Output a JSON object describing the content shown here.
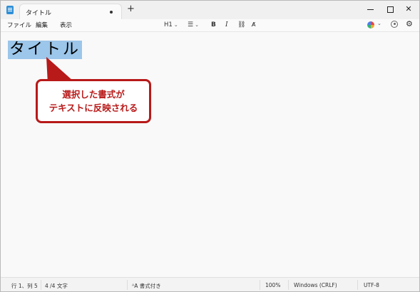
{
  "tab": {
    "title": "タイトル"
  },
  "menu": {
    "file": "ファイル",
    "edit": "編集",
    "view": "表示"
  },
  "toolbar": {
    "heading": "H1",
    "bold": "B",
    "italic": "I",
    "clear_format": "A̸"
  },
  "document": {
    "heading": "タイトル"
  },
  "callout": {
    "line1": "選択した書式が",
    "line2": "テキストに反映される"
  },
  "status": {
    "position": "行 1、列 5",
    "char_count": "4 /4 文字",
    "format": "書式付き",
    "zoom": "100%",
    "line_ending": "Windows (CRLF)",
    "encoding": "UTF-8"
  },
  "colors": {
    "selection": "#9cc6ea",
    "callout_accent": "#b81919"
  }
}
